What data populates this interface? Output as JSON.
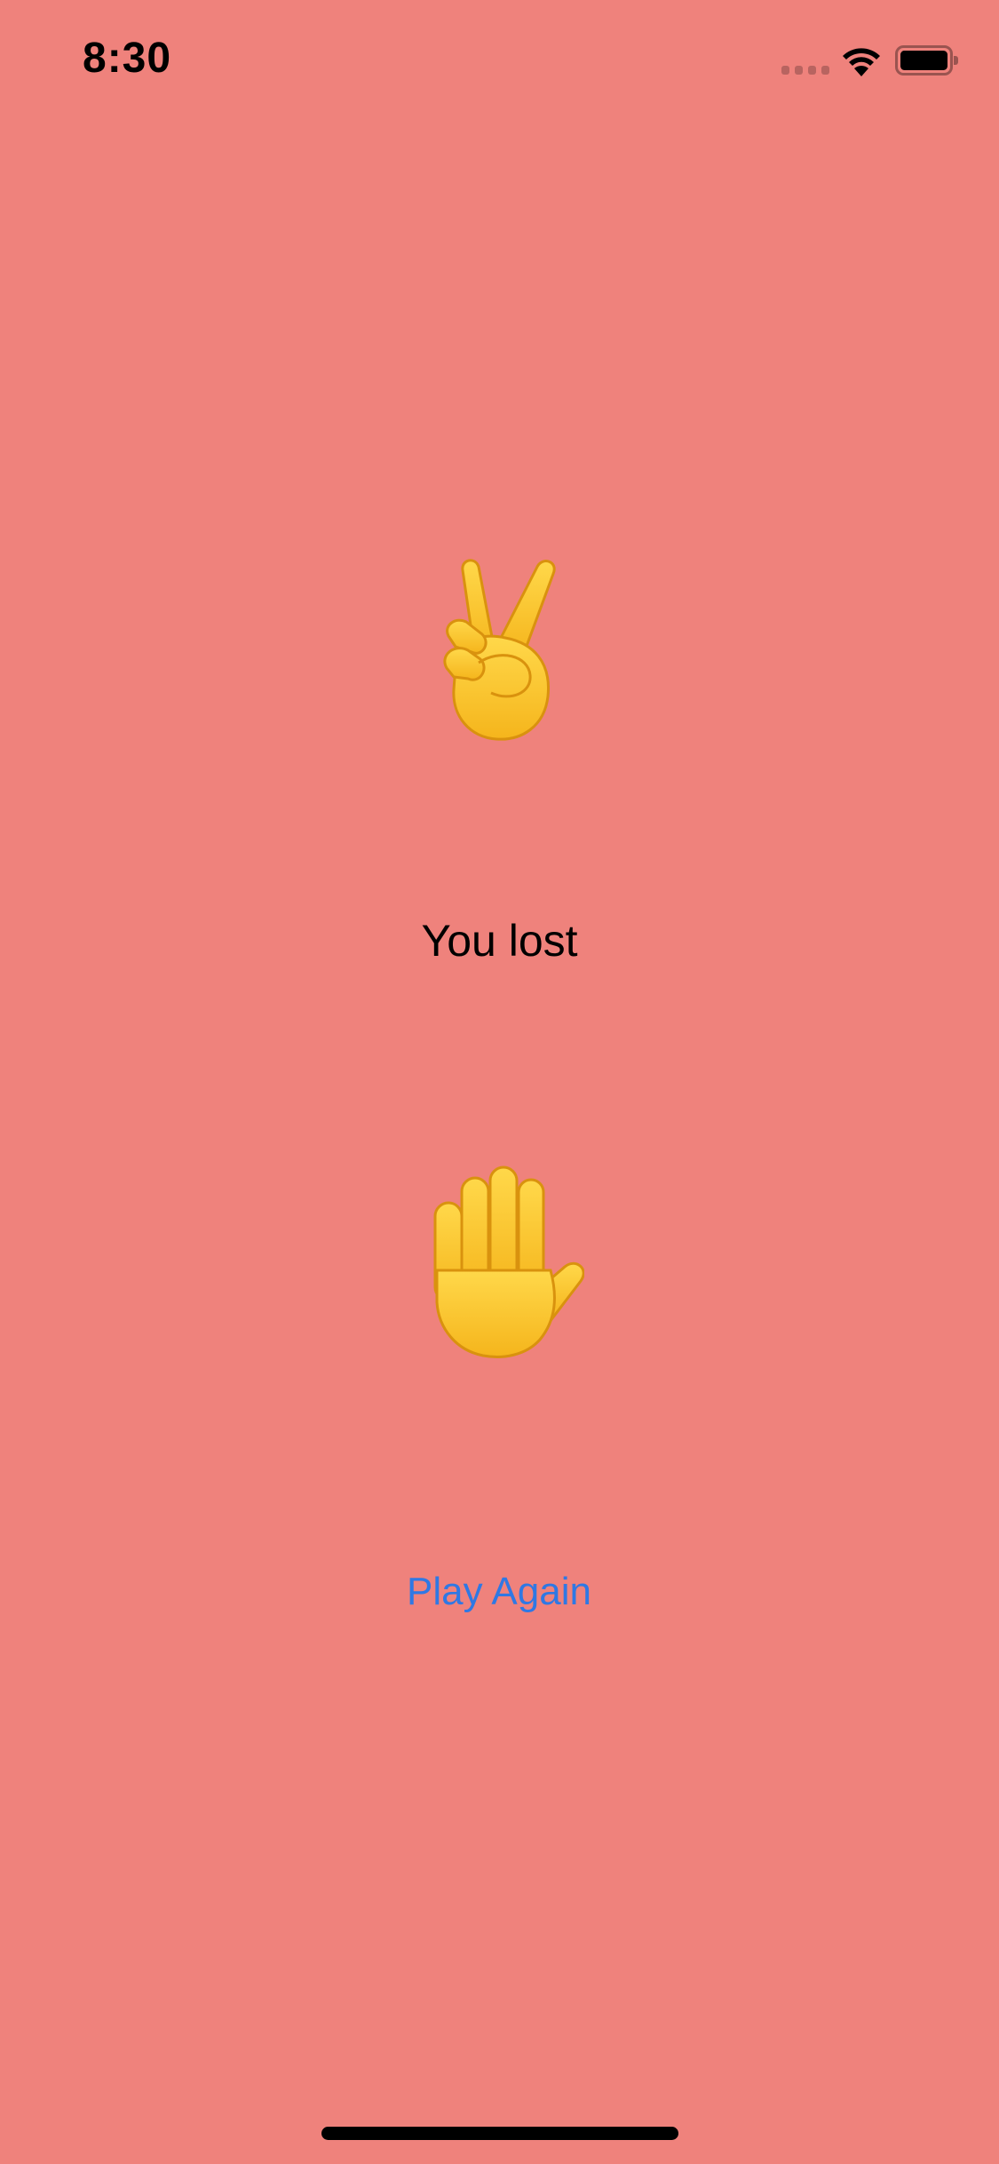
{
  "status_bar": {
    "time": "8:30",
    "icons": [
      "cellular-signal-icon",
      "wifi-icon",
      "battery-icon"
    ]
  },
  "game": {
    "computer_choice_icon": "victory-hand-icon",
    "result_text": "You lost",
    "player_choice_icon": "raised-hand-icon",
    "play_again_label": "Play Again"
  },
  "colors": {
    "background": "#EF827C",
    "button_text": "#2F78E4",
    "emoji_yellow": "#FFCB3D"
  }
}
